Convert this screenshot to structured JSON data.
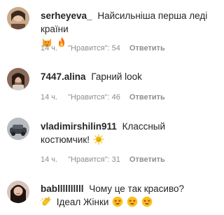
{
  "comments": [
    {
      "username": "serheyeva_",
      "text": "Найсильніша перша леді країни",
      "emojis": [
        "cat-heart-eyes-icon",
        "fire-icon"
      ],
      "time": "14 ч.",
      "likes": "\"Нравится\": 54",
      "reply": "Ответить"
    },
    {
      "username": "7447.alina",
      "text": "Гарний look",
      "emojis": [],
      "time": "14 ч.",
      "likes": "\"Нравится\": 46",
      "reply": "Ответить"
    },
    {
      "username": "vladimirshilin911",
      "text": "Классный",
      "text2": "костюмчик!",
      "emojis": [
        "sun-face-icon"
      ],
      "time": "14 ч.",
      "likes": "\"Нравится\": 31",
      "reply": "Ответить"
    },
    {
      "username": "babllllllllll",
      "text": "Чому це так красиво?",
      "text2": "Ідеал Жінки",
      "emojis": [
        "clapping-hands-icon",
        "heart-eyes-icon",
        "heart-eyes-icon",
        "heart-eyes-icon"
      ]
    }
  ],
  "colors": {
    "text": "#262626",
    "meta": "#8e8e8e"
  }
}
